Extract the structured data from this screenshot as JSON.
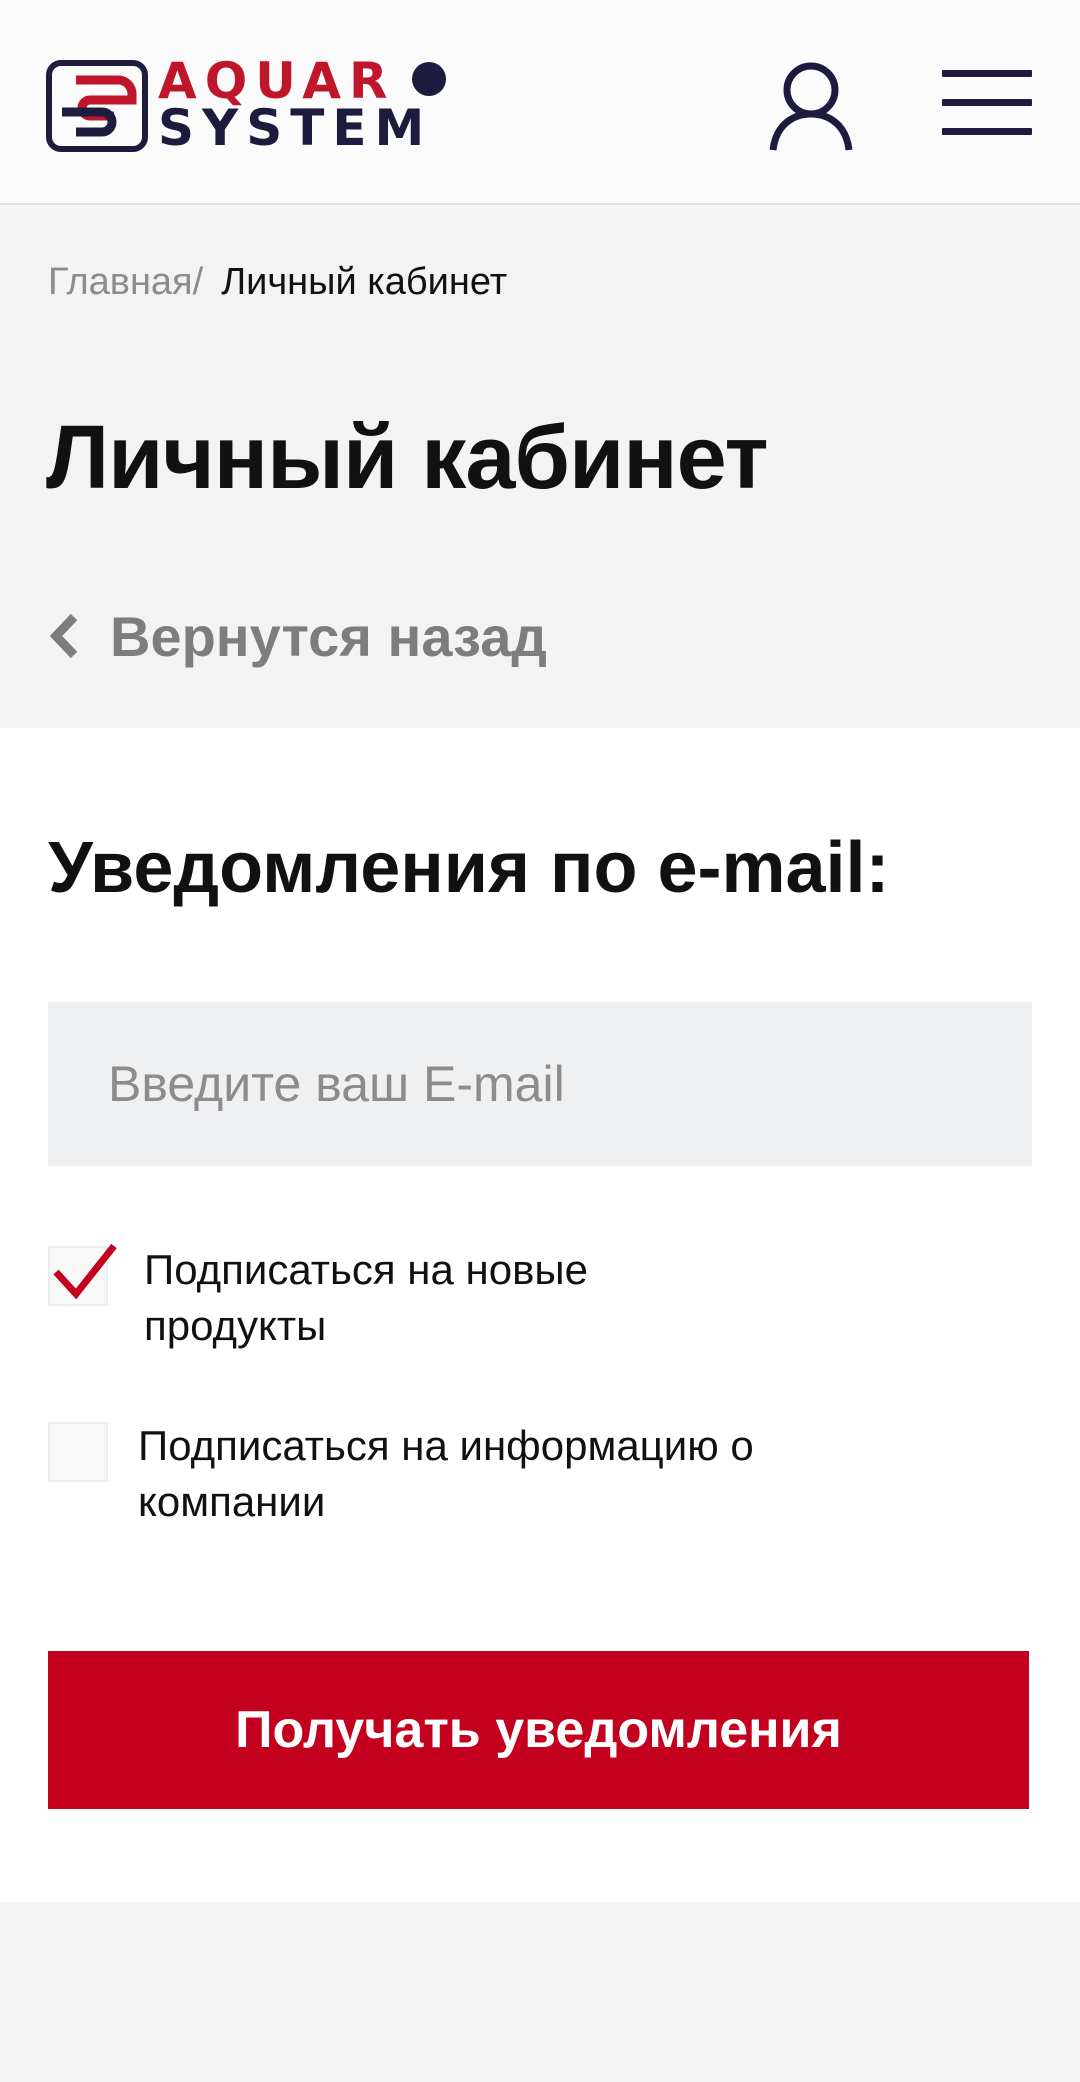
{
  "header": {
    "logo_top": "AQUAR",
    "logo_bottom": "SYSTEM",
    "user_icon": "user-icon",
    "menu_icon": "hamburger-menu-icon",
    "brand_red": "#c0162b",
    "brand_navy": "#1d1c3f"
  },
  "breadcrumb": {
    "home": "Главная",
    "separator": "/",
    "current": "Личный кабинет"
  },
  "page": {
    "title": "Личный кабинет",
    "back_label": "Вернутся назад"
  },
  "notifications": {
    "title": "Уведомления по e-mail:",
    "email_placeholder": "Введите ваш E-mail",
    "email_value": "",
    "options": [
      {
        "line1": "Подписаться на новые",
        "line2": "продукты",
        "checked": true
      },
      {
        "line1": "Подписаться на информацию о",
        "line2": "компании",
        "checked": false
      }
    ],
    "submit_label": "Получать уведомления",
    "accent_color": "#c3001e"
  }
}
